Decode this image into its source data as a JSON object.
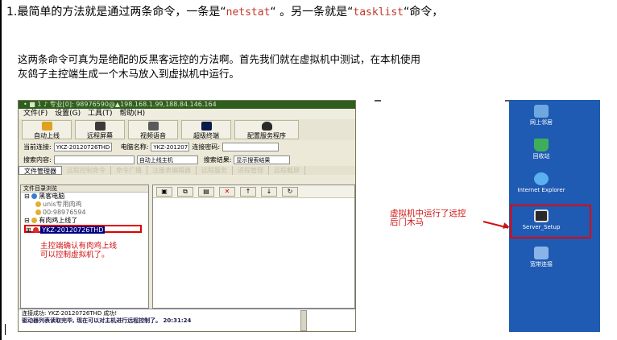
{
  "intro": {
    "prefix": "1.",
    "text_a": "最简单的方法就是通过两条命令，一条是“",
    "cmd_a": "netstat",
    "text_b": "“ 。另一条就是“",
    "cmd_b": "tasklist",
    "text_c": "“命令，"
  },
  "paragraph": [
    "这两条命令可真为是绝配的反黑客远控的方法啊。首先我们就在虚拟机中测试，在本机使用",
    "灰鸽子主控端生成一个木马放入到虚拟机中运行。"
  ],
  "rc_window": {
    "title": "• ■ 1 ♪ 专业[0]: 98976590@▲198.168.1.99,188.84.146.164",
    "menu": [
      "文件(F)",
      "设置(G)",
      "工具(T)",
      "帮助(H)"
    ],
    "toolbar": [
      "自动上线",
      "远程屏幕",
      "视频语音",
      "超级终端",
      "配置服务程序"
    ],
    "row1": {
      "label_a": "当前连接:",
      "value_a": "YKZ-20120726THD",
      "label_b": "电脑名称:",
      "value_b": "YKZ-201207",
      "label_c": "连接密码:",
      "value_c": ""
    },
    "row2": {
      "label_a": "搜索内容:",
      "value_a": "",
      "value_b": "自动上线主机",
      "label_c": "搜索结果:",
      "value_c": "显示搜索结果"
    },
    "tabs": [
      "文件管理器",
      "远程控制命令",
      "命令广播",
      "注册表编辑器",
      "远程服务",
      "进程管理",
      "远程截屏"
    ],
    "tree": {
      "header": "文件目录浏览",
      "nodes": [
        "黑客电脑",
        "unis专用肉鸡",
        "00:98976594",
        "有肉鸡上线了",
        "YKZ-20120726THD"
      ]
    },
    "annotation": [
      "主控端确认有肉鸡上线",
      "可以控制虚拟机了。"
    ],
    "log": [
      "连接成功: YKZ-20120726THD 成功!",
      "驱动器列表读取完毕, 现在可以对主机进行远程控制了。 20:31:24"
    ]
  },
  "vm_desktop": {
    "icons": [
      "网上邻居",
      "回收站",
      "Internet Explorer",
      "Server_Setup",
      "宽带连接"
    ],
    "annotation": [
      "虚拟机中运行了远控",
      "后门木马"
    ]
  },
  "colors": {
    "command": "#c0392b",
    "annotation": "#d01010",
    "desktop": "#1f5bb3"
  }
}
